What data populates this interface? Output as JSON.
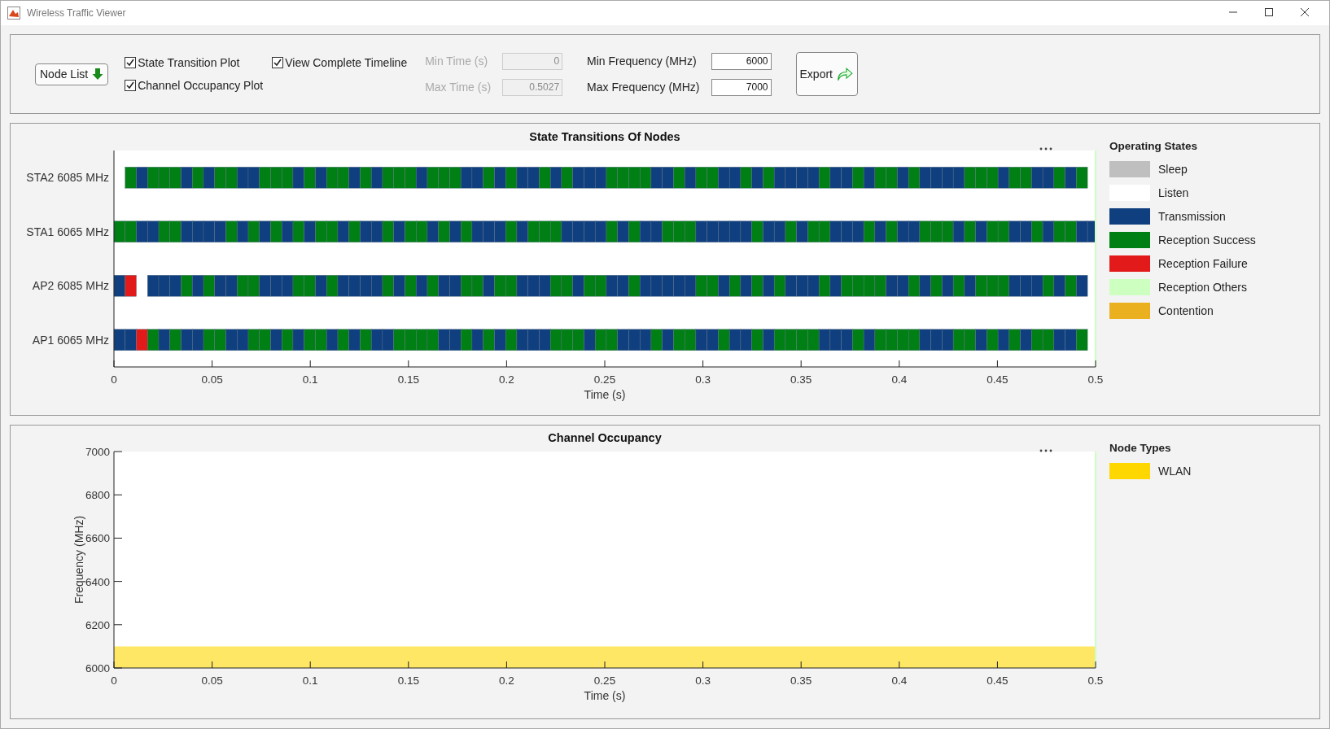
{
  "window": {
    "title": "Wireless Traffic Viewer"
  },
  "controls": {
    "node_list_button": "Node List",
    "checkboxes": [
      {
        "label": "State Transition Plot",
        "checked": true
      },
      {
        "label": "Channel Occupancy Plot",
        "checked": true
      },
      {
        "label": "View Complete Timeline",
        "checked": true
      }
    ],
    "fields": [
      {
        "label": "Min Time (s)",
        "value": "0",
        "disabled": true
      },
      {
        "label": "Max Time (s)",
        "value": "0.5027",
        "disabled": true
      },
      {
        "label": "Min Frequency (MHz)",
        "value": "6000",
        "disabled": false
      },
      {
        "label": "Max Frequency (MHz)",
        "value": "7000",
        "disabled": false
      }
    ],
    "export_button": "Export"
  },
  "state_panel": {
    "plot": {
      "title": "State Transitions Of Nodes",
      "x_label": "Time (s)",
      "x_tick_labels": [
        "0",
        "0.05",
        "0.1",
        "0.15",
        "0.2",
        "0.25",
        "0.3",
        "0.35",
        "0.4",
        "0.45",
        "0.5"
      ],
      "row_labels": [
        "STA2 6085 MHz",
        "STA1 6065 MHz",
        "AP2 6085 MHz",
        "AP1 6065 MHz"
      ]
    },
    "legend": {
      "title": "Operating States",
      "items": [
        {
          "label": "Sleep",
          "color": "#bfbfbf"
        },
        {
          "label": "Listen",
          "color": "#ffffff"
        },
        {
          "label": "Transmission",
          "color": "#0f3f7f"
        },
        {
          "label": "Reception Success",
          "color": "#007f14"
        },
        {
          "label": "Reception Failure",
          "color": "#e21a1a"
        },
        {
          "label": "Reception Others",
          "color": "#ccffc0"
        },
        {
          "label": "Contention",
          "color": "#ebb020"
        }
      ]
    }
  },
  "occupancy_panel": {
    "chart_data": {
      "type": "area",
      "title": "Channel Occupancy",
      "xlabel": "Time (s)",
      "ylabel": "Frequency (MHz)",
      "xlim": [
        0,
        0.5
      ],
      "ylim": [
        6000,
        7000
      ],
      "xticks": [
        {
          "value": 0,
          "label": "0"
        },
        {
          "value": 0.05,
          "label": "0.05"
        },
        {
          "value": 0.1,
          "label": "0.1"
        },
        {
          "value": 0.15,
          "label": "0.15"
        },
        {
          "value": 0.2,
          "label": "0.2"
        },
        {
          "value": 0.25,
          "label": "0.25"
        },
        {
          "value": 0.3,
          "label": "0.3"
        },
        {
          "value": 0.35,
          "label": "0.35"
        },
        {
          "value": 0.4,
          "label": "0.4"
        },
        {
          "value": 0.45,
          "label": "0.45"
        },
        {
          "value": 0.5,
          "label": "0.5"
        }
      ],
      "yticks": [
        6000,
        6200,
        6400,
        6600,
        6800,
        7000
      ],
      "x": [
        0,
        0.5
      ],
      "series": [
        {
          "name": "WLAN",
          "color": "#ffd700",
          "values": [
            6100,
            6100
          ]
        }
      ]
    },
    "legend_title": "Node Types"
  }
}
